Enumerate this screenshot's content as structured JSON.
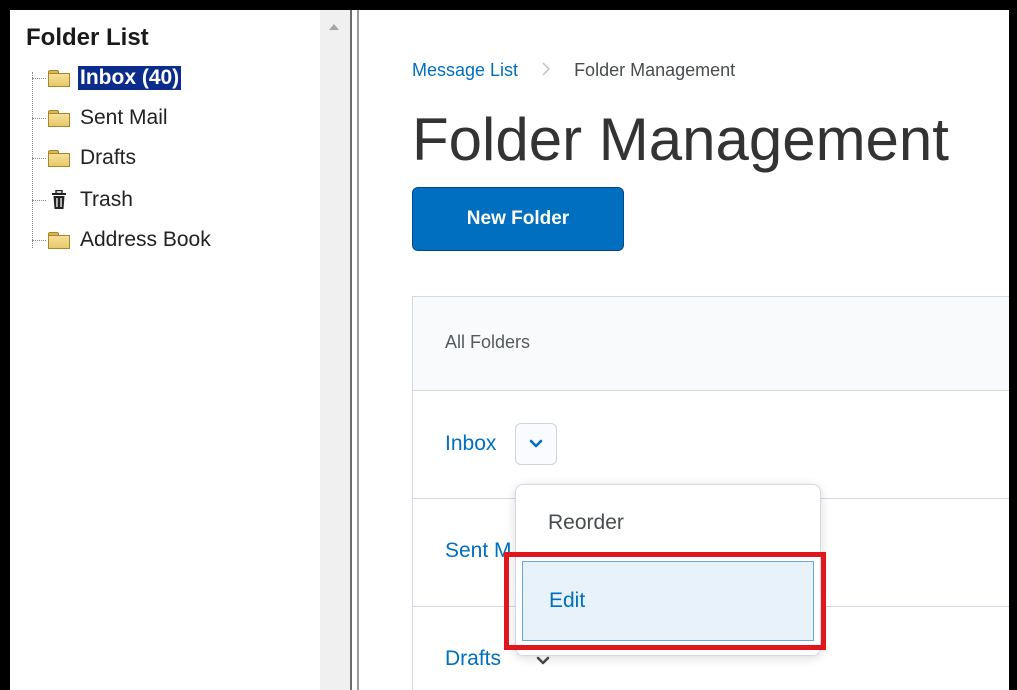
{
  "left_pane": {
    "title": "Folder List",
    "items": [
      {
        "label": "Inbox (40)",
        "icon": "folder-icon",
        "selected": true
      },
      {
        "label": "Sent Mail",
        "icon": "folder-icon",
        "selected": false
      },
      {
        "label": "Drafts",
        "icon": "folder-icon",
        "selected": false
      },
      {
        "label": "Trash",
        "icon": "trash-icon",
        "selected": false
      },
      {
        "label": "Address Book",
        "icon": "folder-icon",
        "selected": false
      }
    ]
  },
  "breadcrumb": {
    "link": "Message List",
    "separator": ">",
    "current": "Folder Management"
  },
  "page_title": "Folder Management",
  "new_folder_button": "New Folder",
  "panel": {
    "header": "All Folders",
    "rows": [
      {
        "label": "Inbox"
      },
      {
        "label": "Sent M"
      },
      {
        "label": "Drafts"
      }
    ]
  },
  "dropdown": {
    "items": [
      {
        "label": "Reorder"
      },
      {
        "label": "Edit"
      }
    ]
  },
  "colors": {
    "primary": "#006fbf",
    "selection": "#0b2c8c",
    "highlight": "#e0161c",
    "text": "#333333"
  }
}
